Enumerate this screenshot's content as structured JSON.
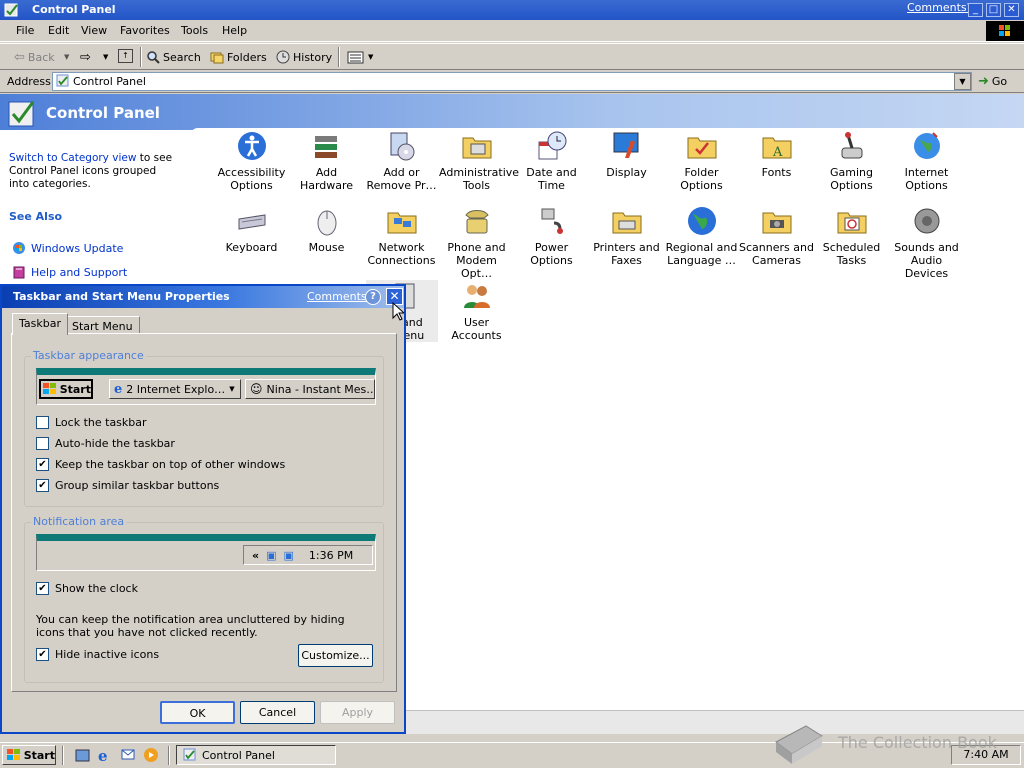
{
  "window": {
    "title": "Control Panel",
    "comments": "Comments?",
    "min": "_",
    "max": "□",
    "close": "✕"
  },
  "menu": [
    "File",
    "Edit",
    "View",
    "Favorites",
    "Tools",
    "Help"
  ],
  "toolbar": {
    "back": "Back",
    "search": "Search",
    "folders": "Folders",
    "history": "History"
  },
  "address": {
    "label": "Address",
    "value": "Control Panel",
    "go": "Go"
  },
  "header": {
    "title": "Control Panel"
  },
  "left": {
    "switch_link": "Switch to Category view",
    "switch_rest": " to see Control Panel icons grouped into categories.",
    "see_also": "See Also",
    "items": [
      "Windows Update",
      "Help and Support"
    ]
  },
  "icons": [
    {
      "label": "Accessibility Options",
      "icon": "accessibility-icon"
    },
    {
      "label": "Add Hardware",
      "icon": "add-hardware-icon"
    },
    {
      "label": "Add or Remove Pr…",
      "icon": "add-remove-programs-icon"
    },
    {
      "label": "Administrative Tools",
      "icon": "admin-tools-icon"
    },
    {
      "label": "Date and Time",
      "icon": "date-time-icon"
    },
    {
      "label": "Display",
      "icon": "display-icon"
    },
    {
      "label": "Folder Options",
      "icon": "folder-options-icon"
    },
    {
      "label": "Fonts",
      "icon": "fonts-icon"
    },
    {
      "label": "Gaming Options",
      "icon": "gaming-options-icon"
    },
    {
      "label": "Internet Options",
      "icon": "internet-options-icon"
    },
    {
      "label": "Keyboard",
      "icon": "keyboard-icon"
    },
    {
      "label": "Mouse",
      "icon": "mouse-icon"
    },
    {
      "label": "Network Connections",
      "icon": "network-connections-icon"
    },
    {
      "label": "Phone and Modem Opt…",
      "icon": "phone-modem-icon"
    },
    {
      "label": "Power Options",
      "icon": "power-options-icon"
    },
    {
      "label": "Printers and Faxes",
      "icon": "printers-faxes-icon"
    },
    {
      "label": "Regional and Language …",
      "icon": "regional-language-icon"
    },
    {
      "label": "Scanners and Cameras",
      "icon": "scanners-cameras-icon"
    },
    {
      "label": "Scheduled Tasks",
      "icon": "scheduled-tasks-icon"
    },
    {
      "label": "Sounds and Audio Devices",
      "icon": "sounds-audio-icon"
    },
    {
      "label": "r and Menu",
      "icon": "taskbar-start-menu-icon"
    },
    {
      "label": "User Accounts",
      "icon": "user-accounts-icon"
    }
  ],
  "dialog": {
    "title": "Taskbar and Start Menu Properties",
    "comments": "Comments?",
    "help": "?",
    "close": "✕",
    "tabs": [
      "Taskbar",
      "Start Menu"
    ],
    "appearance_title": "Taskbar appearance",
    "preview": {
      "start": "Start",
      "ie": "2 Internet Explo…",
      "msg": "Nina - Instant Mes…"
    },
    "checks": [
      {
        "label": "Lock the taskbar",
        "checked": false
      },
      {
        "label": "Auto-hide the taskbar",
        "checked": false
      },
      {
        "label": "Keep the taskbar on top of other windows",
        "checked": true
      },
      {
        "label": "Group similar taskbar buttons",
        "checked": true
      }
    ],
    "notify_title": "Notification area",
    "notify_preview": {
      "chevron": "«",
      "time": "1:36 PM"
    },
    "show_clock": {
      "label": "Show the clock",
      "checked": true
    },
    "info": "You can keep the notification area uncluttered by hiding icons that you have not clicked recently.",
    "hide_inactive": {
      "label": "Hide inactive icons",
      "checked": true
    },
    "customize": "Customize...",
    "ok": "OK",
    "cancel": "Cancel",
    "apply": "Apply"
  },
  "taskbar": {
    "start": "Start",
    "task": "Control Panel",
    "clock": "7:40 AM"
  },
  "watermark": "The Collection Book"
}
